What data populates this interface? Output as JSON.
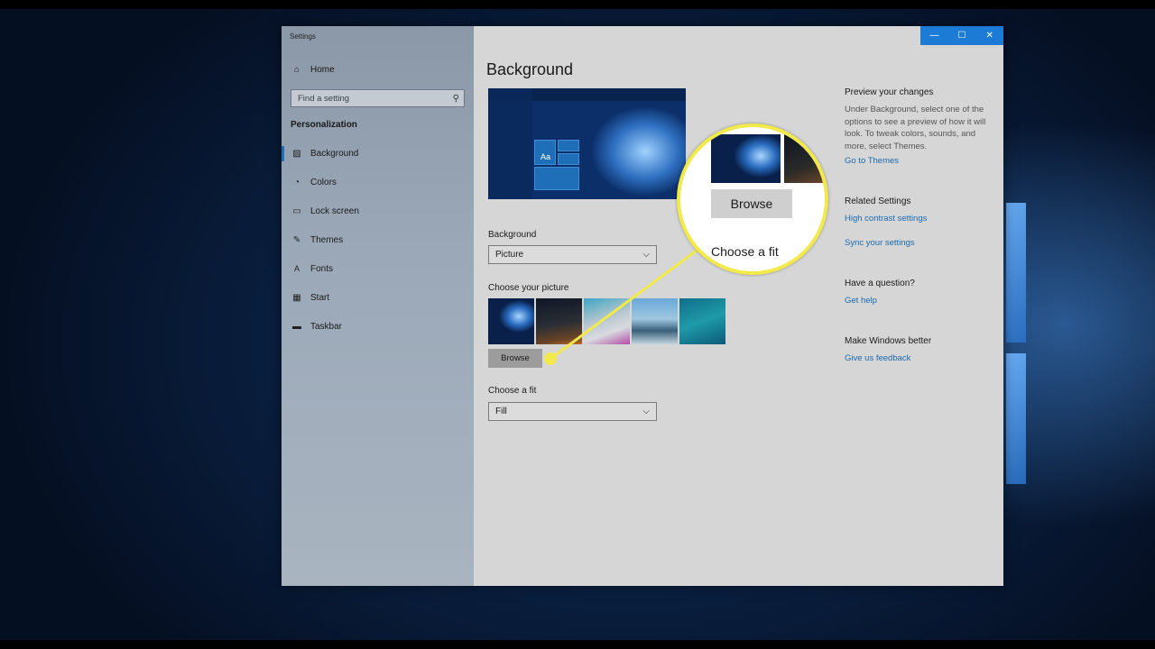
{
  "window": {
    "title": "Settings",
    "controls": {
      "minimize": "—",
      "maximize": "☐",
      "close": "✕"
    }
  },
  "sidebar": {
    "home": {
      "label": "Home",
      "icon": "home-icon"
    },
    "search": {
      "placeholder": "Find a setting"
    },
    "section": "Personalization",
    "items": [
      {
        "label": "Background",
        "icon": "picture-icon",
        "selected": true
      },
      {
        "label": "Colors",
        "icon": "palette-icon"
      },
      {
        "label": "Lock screen",
        "icon": "lock-screen-icon"
      },
      {
        "label": "Themes",
        "icon": "brush-icon"
      },
      {
        "label": "Fonts",
        "icon": "font-icon"
      },
      {
        "label": "Start",
        "icon": "start-icon"
      },
      {
        "label": "Taskbar",
        "icon": "taskbar-icon"
      }
    ]
  },
  "main": {
    "title": "Background",
    "preview_tile_text": "Aa",
    "background_label": "Background",
    "background_value": "Picture",
    "choose_picture_label": "Choose your picture",
    "browse_label": "Browse",
    "choose_fit_label": "Choose a fit",
    "fit_value": "Fill"
  },
  "right": {
    "preview_heading": "Preview your changes",
    "preview_text": "Under Background, select one of the options to see a preview of how it will look. To tweak colors, sounds, and more, select Themes.",
    "go_to_themes": "Go to Themes",
    "related_heading": "Related Settings",
    "high_contrast": "High contrast settings",
    "sync": "Sync your settings",
    "question_heading": "Have a question?",
    "get_help": "Get help",
    "better_heading": "Make Windows better",
    "feedback": "Give us feedback"
  },
  "callout": {
    "browse_label": "Browse",
    "fit_label": "Choose a fit",
    "color": "#f2ea4a"
  }
}
